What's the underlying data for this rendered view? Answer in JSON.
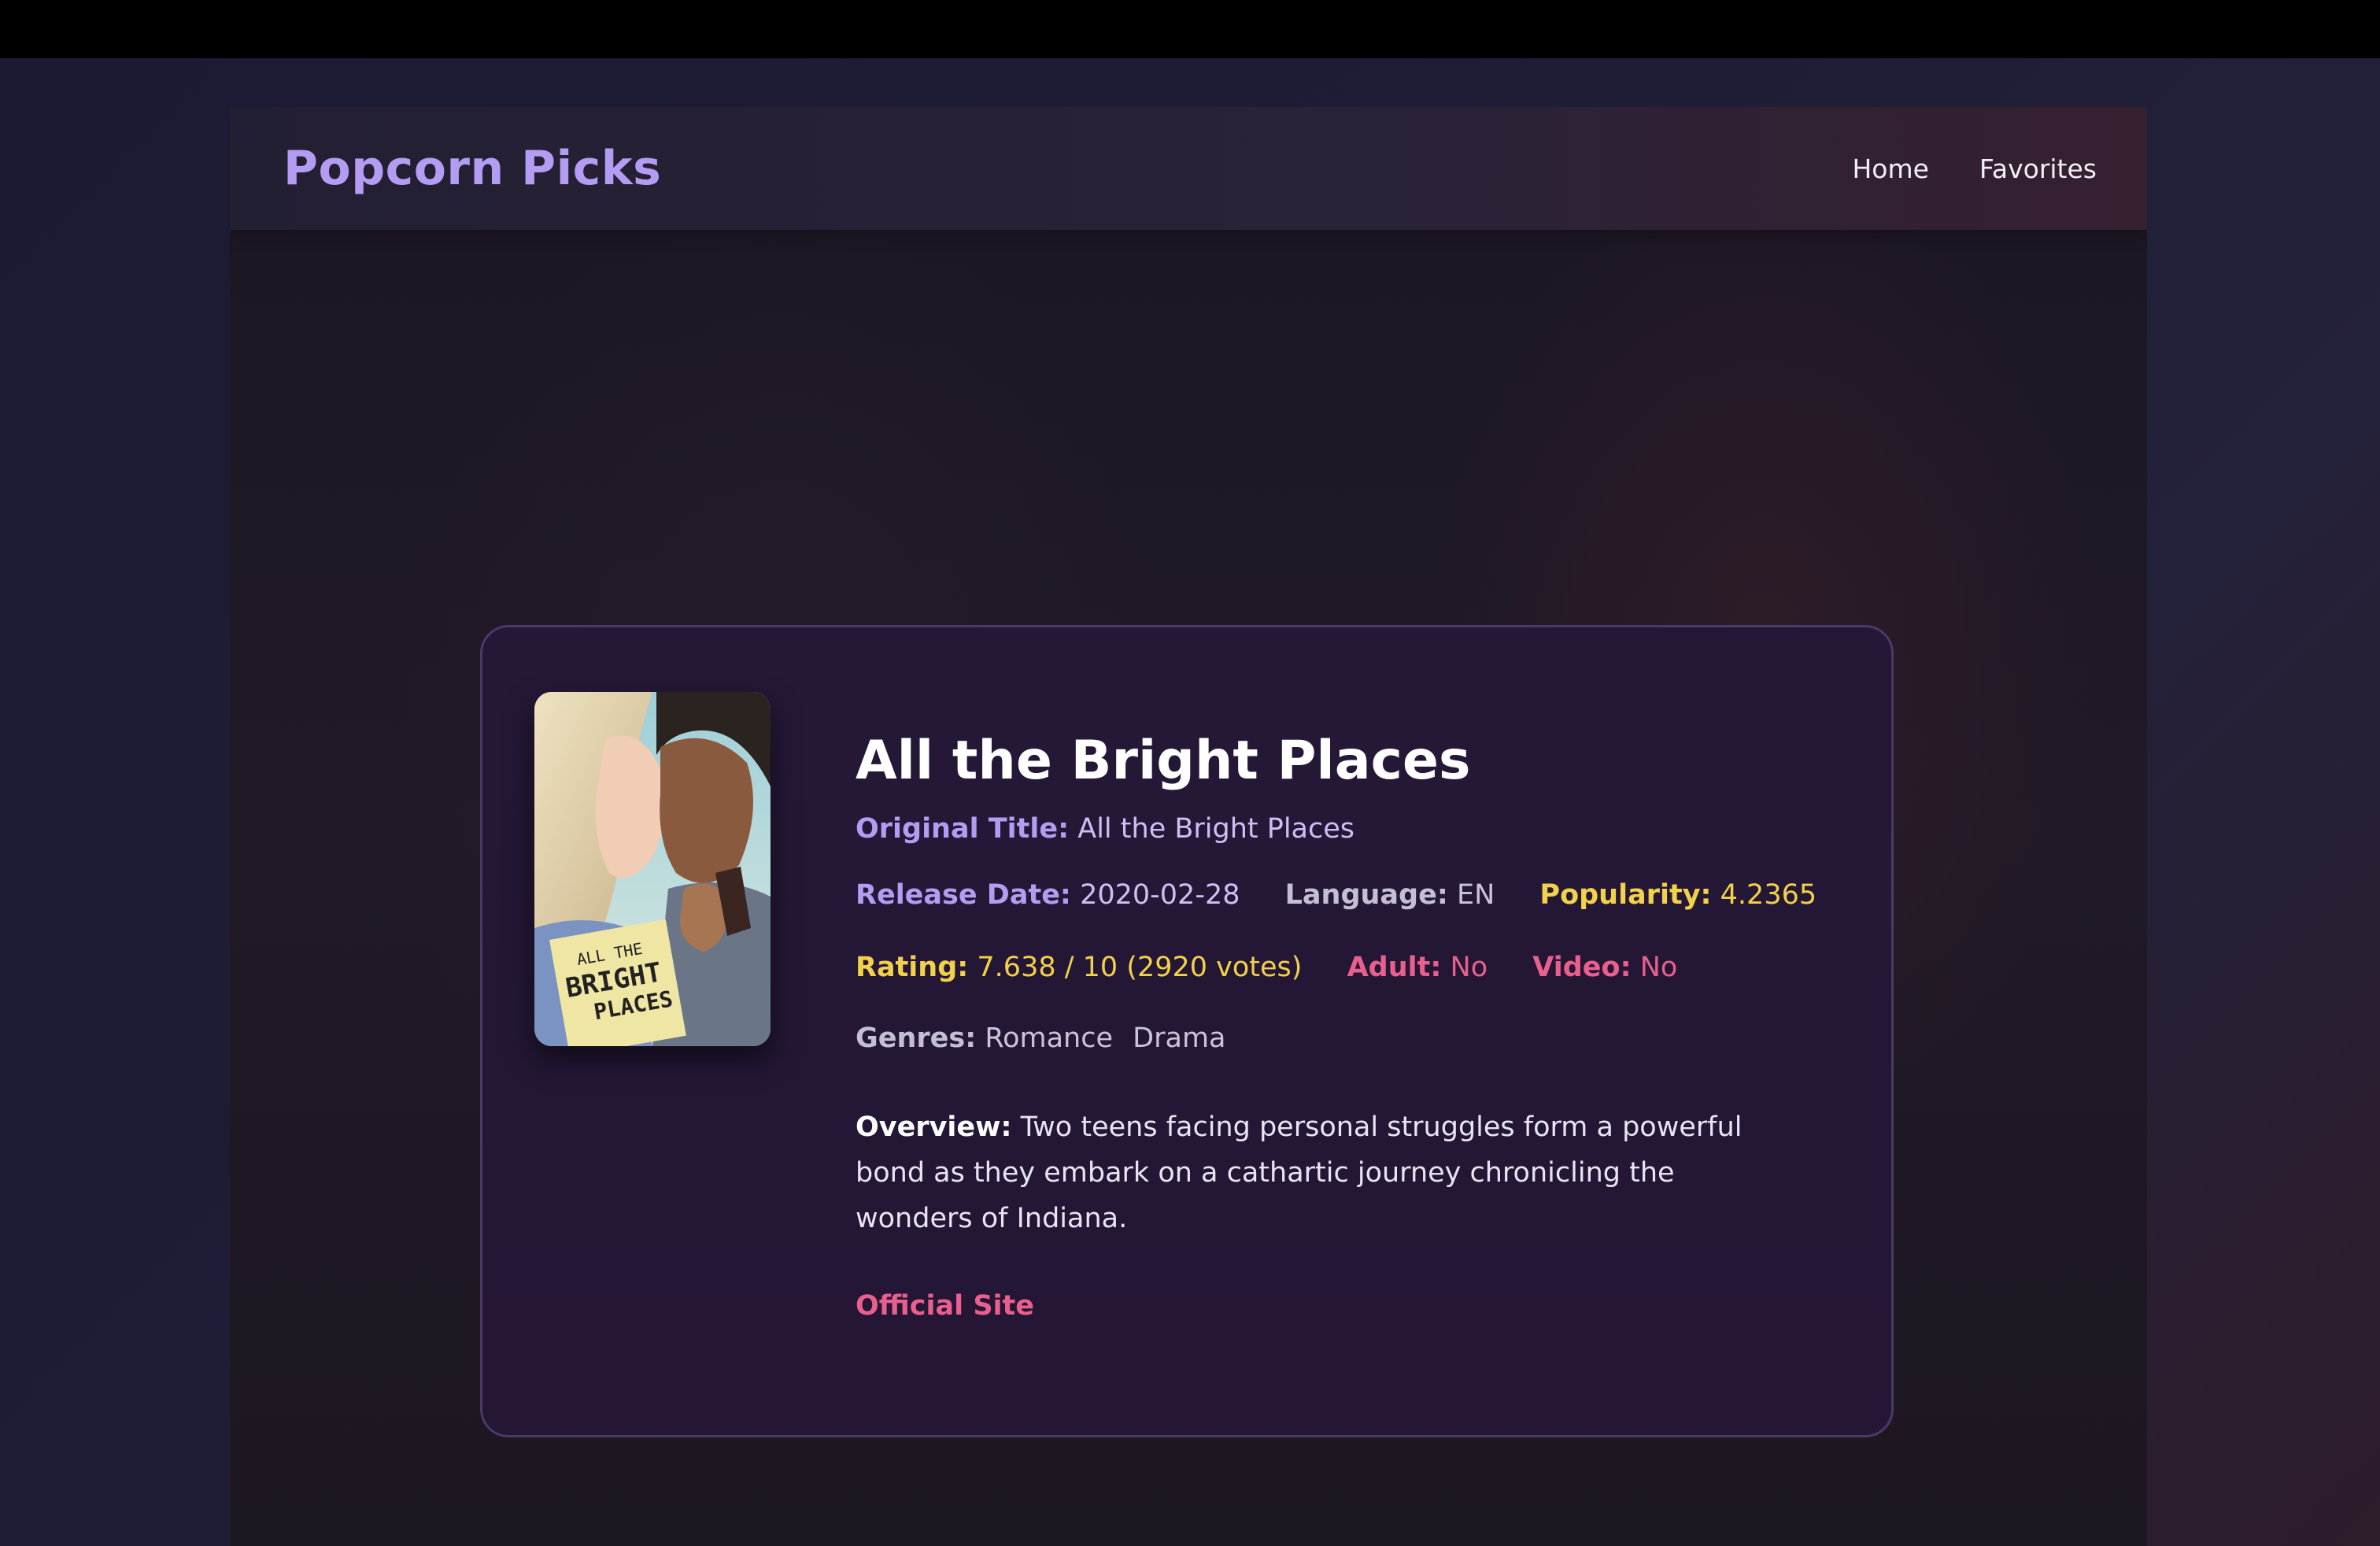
{
  "app": {
    "brand": "Popcorn Picks",
    "nav": [
      "Home",
      "Favorites"
    ]
  },
  "movie": {
    "title": "All the Bright Places",
    "original_title_label": "Original Title:",
    "original_title": "All the Bright Places",
    "release_date_label": "Release Date:",
    "release_date": "2020-02-28",
    "language_label": "Language:",
    "language": "EN",
    "popularity_label": "Popularity:",
    "popularity": "4.2365",
    "rating_label": "Rating:",
    "rating": "7.638 / 10 (2920 votes)",
    "adult_label": "Adult:",
    "adult": "No",
    "video_label": "Video:",
    "video": "No",
    "genres_label": "Genres:",
    "genres": [
      "Romance",
      "Drama"
    ],
    "overview_label": "Overview:",
    "overview": "Two teens facing personal struggles form a powerful bond as they embark on a cathartic journey chronicling the wonders of Indiana.",
    "official_site": "Official Site",
    "poster_text": [
      "ALL THE",
      "BRIGHT",
      "PLACES"
    ]
  },
  "colors": {
    "brand": "#b39cf2",
    "accent_yellow": "#f2d14b",
    "accent_pink": "#e9608e",
    "card_border": "#4a3a66"
  }
}
